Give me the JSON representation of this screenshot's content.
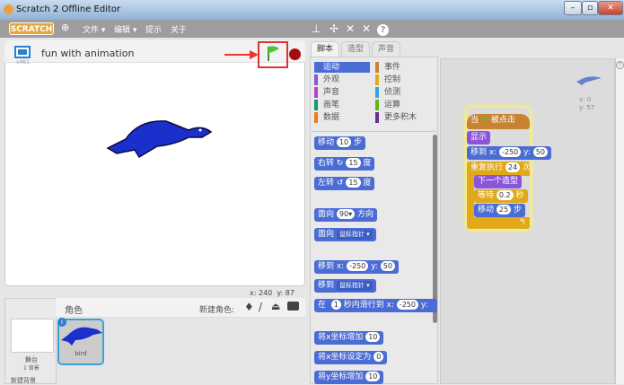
{
  "window": {
    "title": "Scratch 2 Offline Editor",
    "controls": [
      "–",
      "▫",
      "✕"
    ]
  },
  "menubar": {
    "logo": "SCRATCH",
    "items": [
      "文件 ▾",
      "编辑 ▾",
      "提示",
      "关于"
    ],
    "tools": [
      "stamp-icon",
      "grow-icon",
      "shrink-icon",
      "fullscreen-icon",
      "help-icon"
    ]
  },
  "stage": {
    "project_name": "fun with animation",
    "version": "v461",
    "mouse_x": "x: 240",
    "mouse_y": "y: 87"
  },
  "tabs": [
    "脚本",
    "造型",
    "声音"
  ],
  "categories": [
    {
      "label": "运动",
      "color": "#4a6cd4",
      "active": true
    },
    {
      "label": "事件",
      "color": "#c88330"
    },
    {
      "label": "外观",
      "color": "#8a55d7"
    },
    {
      "label": "控制",
      "color": "#e1a91a"
    },
    {
      "label": "声音",
      "color": "#bb42c3"
    },
    {
      "label": "侦测",
      "color": "#2ca5e2"
    },
    {
      "label": "画笔",
      "color": "#0e9a6c"
    },
    {
      "label": "运算",
      "color": "#5cb712"
    },
    {
      "label": "数据",
      "color": "#ee7d16"
    },
    {
      "label": "更多积木",
      "color": "#632d99"
    }
  ],
  "palette_blocks": {
    "move": [
      "移动",
      "10",
      "步"
    ],
    "turn_right": [
      "右转",
      "↻",
      "15",
      "度"
    ],
    "turn_left": [
      "左转",
      "↺",
      "15",
      "度"
    ],
    "point_dir": [
      "面向",
      "90▾",
      "方向"
    ],
    "point_towards": [
      "面向",
      "鼠标指针 ▾"
    ],
    "goto_xy": [
      "移到 x:",
      "-250",
      "y:",
      "50"
    ],
    "goto": [
      "移到",
      "鼠标指针 ▾"
    ],
    "glide": [
      "在",
      "1",
      "秒内滑行到 x:",
      "-250",
      "y:"
    ],
    "change_x": [
      "将x坐标增加",
      "10"
    ],
    "set_x": [
      "将x坐标设定为",
      "0"
    ],
    "change_y": [
      "将y坐标增加",
      "10"
    ]
  },
  "script": {
    "hat": [
      "当",
      "被点击"
    ],
    "show": "显示",
    "goto": [
      "移到 x:",
      "-250",
      "y:",
      "50"
    ],
    "repeat": [
      "重复执行",
      "24",
      "次"
    ],
    "next_costume": "下一个造型",
    "wait": [
      "等待",
      "0.2",
      "秒"
    ],
    "move": [
      "移动",
      "25",
      "步"
    ],
    "sprite_x": "x: 0",
    "sprite_y": "y: 57"
  },
  "sprites": {
    "header": "角色",
    "new_sprite": "新建角色:",
    "stage_label": "舞台",
    "stage_backdrops": "1 背景",
    "new_backdrop": "新建背景",
    "sprite_name": "bird"
  }
}
